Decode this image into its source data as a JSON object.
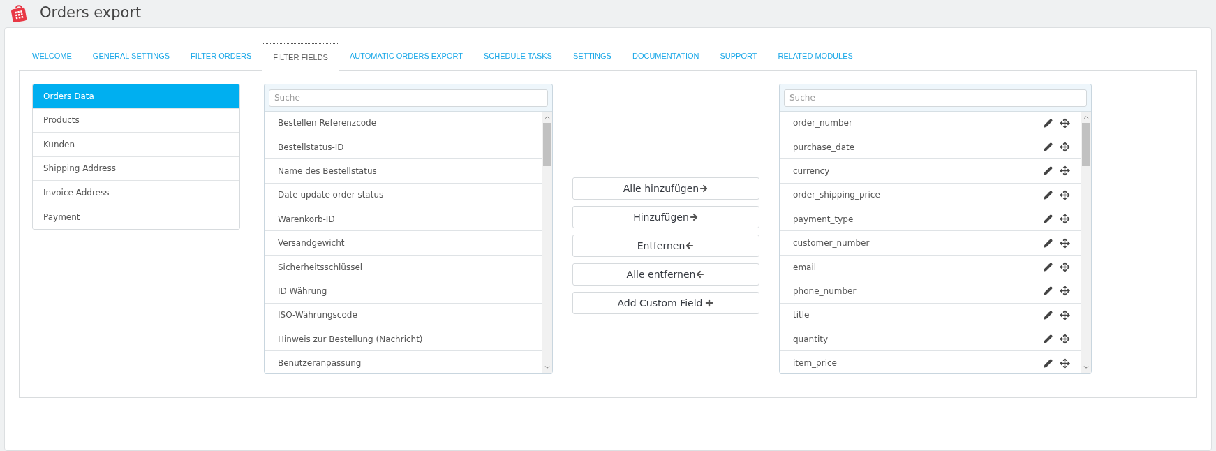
{
  "page": {
    "title": "Orders export"
  },
  "tabs": [
    {
      "label": "WELCOME",
      "selected": false
    },
    {
      "label": "GENERAL SETTINGS",
      "selected": false
    },
    {
      "label": "FILTER ORDERS",
      "selected": false
    },
    {
      "label": "FILTER FIELDS",
      "selected": true
    },
    {
      "label": "AUTOMATIC ORDERS EXPORT",
      "selected": false
    },
    {
      "label": "SCHEDULE TASKS",
      "selected": false
    },
    {
      "label": "SETTINGS",
      "selected": false
    },
    {
      "label": "DOCUMENTATION",
      "selected": false
    },
    {
      "label": "SUPPORT",
      "selected": false
    },
    {
      "label": "RELATED MODULES",
      "selected": false
    }
  ],
  "sidebar": {
    "items": [
      {
        "label": "Orders Data",
        "selected": true
      },
      {
        "label": "Products",
        "selected": false
      },
      {
        "label": "Kunden",
        "selected": false
      },
      {
        "label": "Shipping Address",
        "selected": false
      },
      {
        "label": "Invoice Address",
        "selected": false
      },
      {
        "label": "Payment",
        "selected": false
      }
    ]
  },
  "available_fields": {
    "search": {
      "placeholder": "Suche"
    },
    "items": [
      "Bestellen Referenzcode",
      "Bestellstatus-ID",
      "Name des Bestellstatus",
      "Date update order status",
      "Warenkorb-ID",
      "Versandgewicht",
      "Sicherheitsschlüssel",
      "ID Währung",
      "ISO-Währungscode",
      "Hinweis zur Bestellung (Nachricht)",
      "Benutzeranpassung"
    ]
  },
  "actions": [
    {
      "label": "Alle hinzufügen",
      "kind": "right"
    },
    {
      "label": "Hinzufügen",
      "kind": "right"
    },
    {
      "label": "Entfernen",
      "kind": "left"
    },
    {
      "label": "Alle entfernen",
      "kind": "left"
    },
    {
      "label": "Add Custom Field",
      "kind": "plus"
    }
  ],
  "selected_fields": {
    "search": {
      "placeholder": "Suche"
    },
    "items": [
      "order_number",
      "purchase_date",
      "currency",
      "order_shipping_price",
      "payment_type",
      "customer_number",
      "email",
      "phone_number",
      "title",
      "quantity",
      "item_price"
    ]
  }
}
